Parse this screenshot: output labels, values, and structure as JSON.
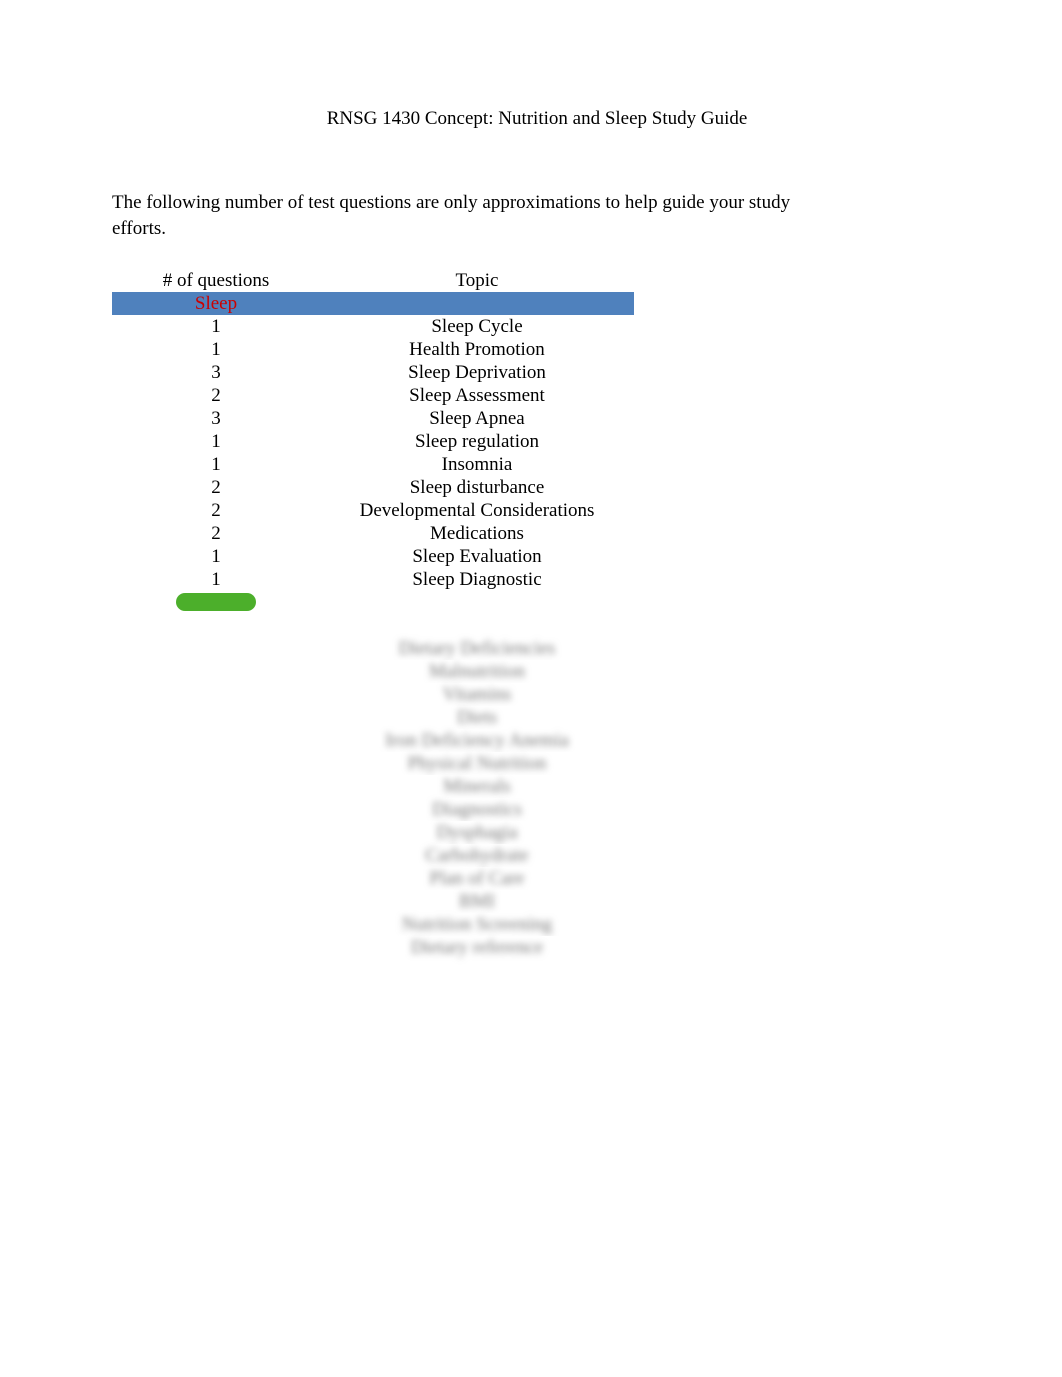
{
  "title": "RNSG 1430 Concept: Nutrition and Sleep Study Guide",
  "intro": "The following number of test questions are only approximations to help guide your study efforts.",
  "table": {
    "headers": {
      "questions": "# of questions",
      "topic": "Topic"
    },
    "section1": {
      "label": "Sleep",
      "rows": [
        {
          "q": "1",
          "t": "Sleep Cycle"
        },
        {
          "q": "1",
          "t": "Health Promotion"
        },
        {
          "q": "3",
          "t": "Sleep Deprivation"
        },
        {
          "q": "2",
          "t": "Sleep Assessment"
        },
        {
          "q": "3",
          "t": "Sleep Apnea"
        },
        {
          "q": "1",
          "t": "Sleep regulation"
        },
        {
          "q": "1",
          "t": "Insomnia"
        },
        {
          "q": "2",
          "t": "Sleep disturbance"
        },
        {
          "q": "2",
          "t": "Developmental Considerations"
        },
        {
          "q": "2",
          "t": "Medications"
        },
        {
          "q": "1",
          "t": "Sleep Evaluation"
        },
        {
          "q": "1",
          "t": "Sleep Diagnostic"
        }
      ]
    },
    "section2": {
      "rows": [
        {
          "q": "",
          "t": ""
        },
        {
          "q": "",
          "t": "Dietary Deficiencies"
        },
        {
          "q": "",
          "t": "Malnutrition"
        },
        {
          "q": "",
          "t": "Vitamins"
        },
        {
          "q": "",
          "t": "Diets"
        },
        {
          "q": "",
          "t": "Iron Deficiency Anemia"
        },
        {
          "q": "",
          "t": "Physical Nutrition"
        },
        {
          "q": "",
          "t": "Minerals"
        },
        {
          "q": "",
          "t": "Diagnostics"
        },
        {
          "q": "",
          "t": "Dysphagia"
        },
        {
          "q": "",
          "t": "Carbohydrate"
        },
        {
          "q": "",
          "t": "Plan of Care"
        },
        {
          "q": "",
          "t": "BMI"
        },
        {
          "q": "",
          "t": "Nutrition Screening"
        },
        {
          "q": "",
          "t": "Dietary reference"
        }
      ]
    }
  }
}
